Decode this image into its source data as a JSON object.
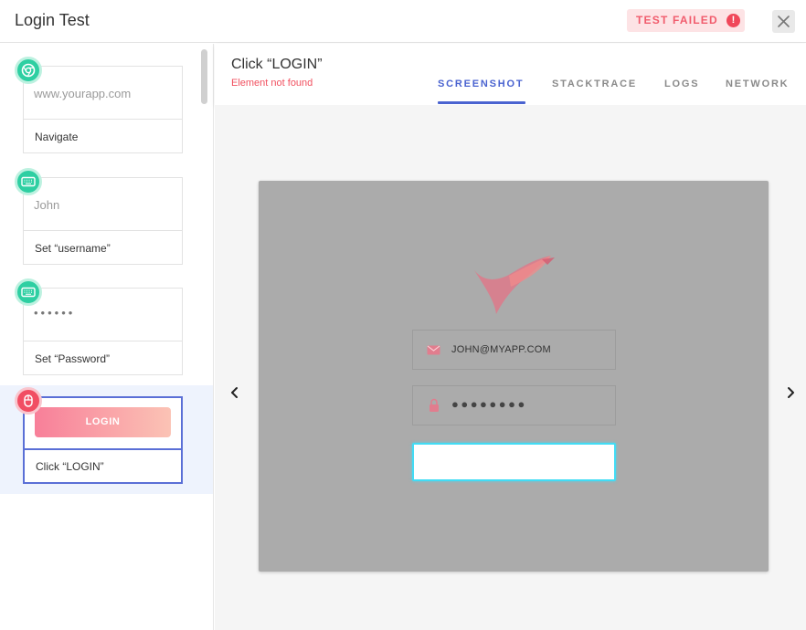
{
  "header": {
    "title": "Login Test",
    "status_badge": "TEST FAILED",
    "status_icon": "!"
  },
  "steps": [
    {
      "preview": "www.yourapp.com",
      "label": "Navigate",
      "icon": "chrome-icon"
    },
    {
      "preview": "John",
      "label": "Set “username”",
      "icon": "keyboard-icon"
    },
    {
      "preview": "••••••",
      "label": "Set “Password”",
      "icon": "keyboard-icon"
    },
    {
      "preview": "LOGIN",
      "label": "Click “LOGIN”",
      "icon": "mouse-icon",
      "status": "failed"
    }
  ],
  "detail": {
    "title": "Click “LOGIN”",
    "error": "Element not found",
    "tabs": [
      "SCREENSHOT",
      "STACKTRACE",
      "LOGS",
      "NETWORK"
    ],
    "active_tab": "SCREENSHOT"
  },
  "screenshot": {
    "email": "JOHN@MYAPP.COM",
    "password": "●●●●●●●●",
    "icons": [
      "bird-logo-icon",
      "mail-icon",
      "lock-icon"
    ]
  },
  "colors": {
    "accent": "#4a63d0",
    "error": "#f1505f",
    "success": "#2ecfa2",
    "highlight": "#42dcf5"
  }
}
